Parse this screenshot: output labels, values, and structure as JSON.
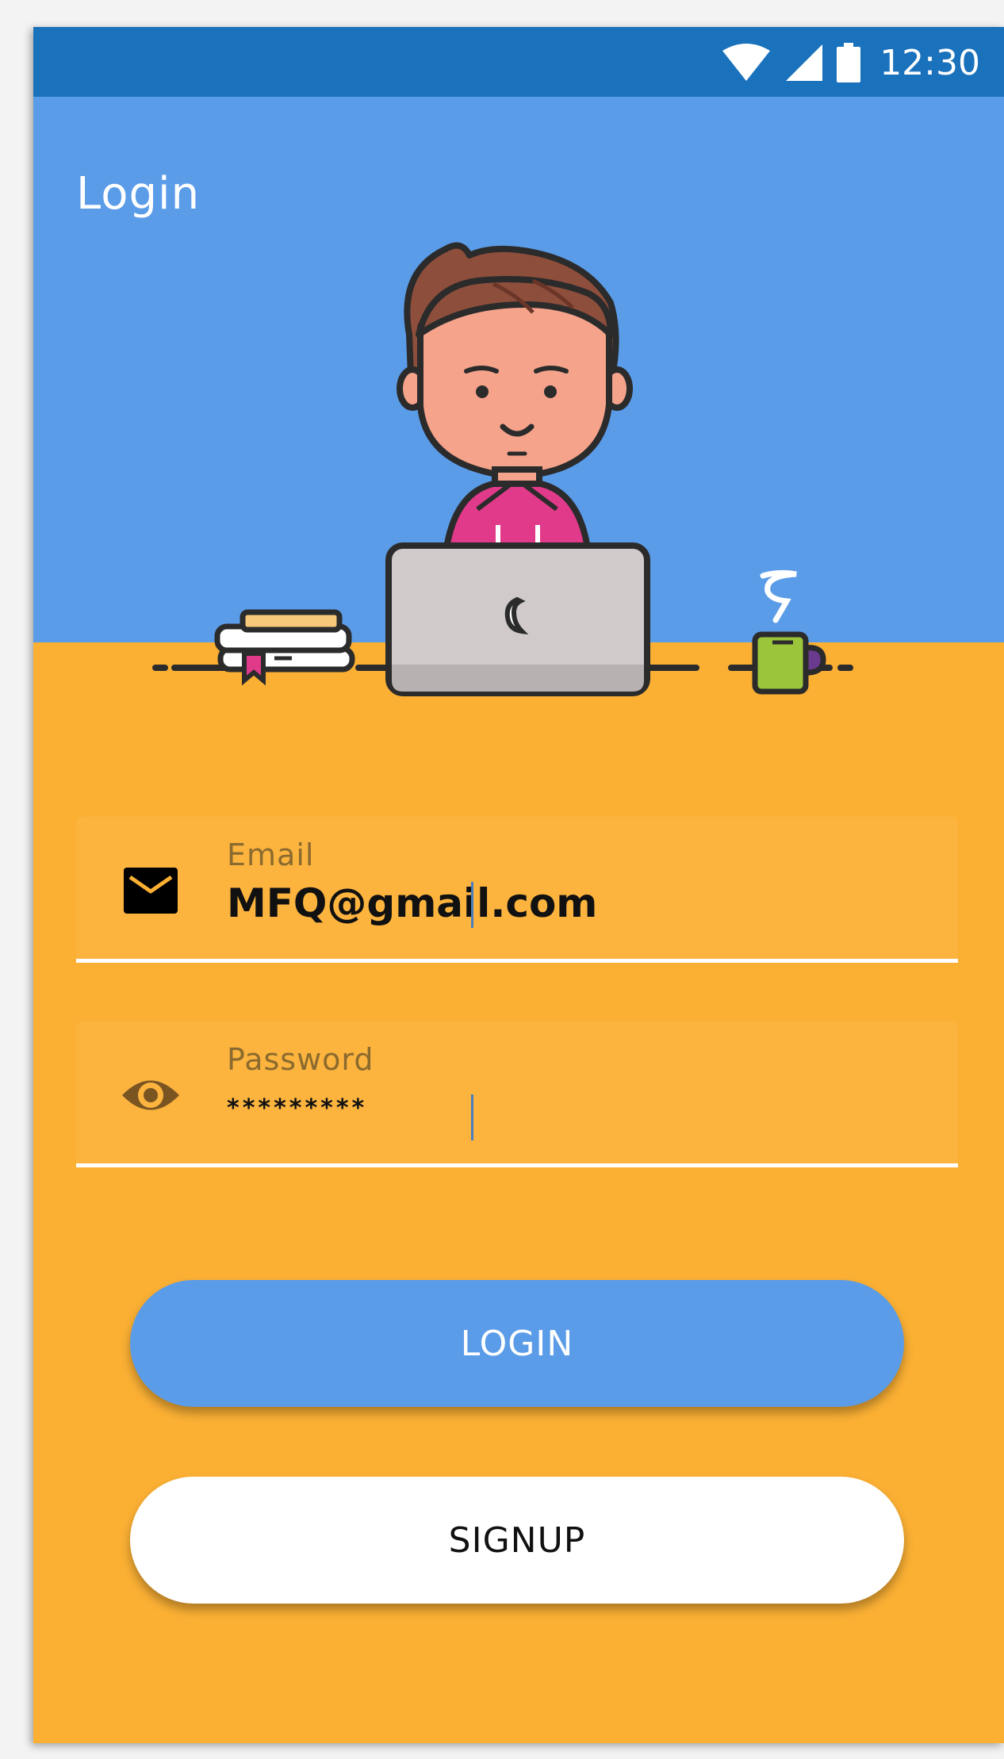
{
  "status_bar": {
    "time": "12:30",
    "icons": [
      "wifi-icon",
      "cell-signal-icon",
      "battery-icon"
    ]
  },
  "header": {
    "title": "Login",
    "illustration": "person-at-laptop-illustration"
  },
  "form": {
    "email": {
      "label": "Email",
      "value": "MFQ@gmail.com",
      "icon": "mail-icon"
    },
    "password": {
      "label": "Password",
      "value": "*********",
      "icon": "eye-icon"
    }
  },
  "buttons": {
    "login_label": "LOGIN",
    "signup_label": "SIGNUP"
  },
  "colors": {
    "status_bar": "#1A71BC",
    "header_bg": "#5B9CE8",
    "body_bg": "#FBB034",
    "login_button": "#5B9CE8",
    "signup_button": "#FFFFFF"
  }
}
